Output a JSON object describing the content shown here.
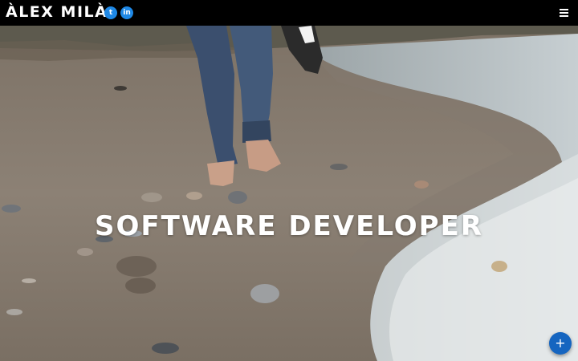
{
  "header": {
    "brand": "ÀLEX MILÀ",
    "social": [
      {
        "name": "twitter",
        "glyph": "t"
      },
      {
        "name": "linkedin",
        "glyph": "in"
      }
    ],
    "menu_icon": "hamburger-icon"
  },
  "hero": {
    "headline": "SOFTWARE DEVELOPER",
    "background": "beach-footsteps-photo"
  },
  "fab": {
    "glyph": "+",
    "icon": "plus-icon"
  },
  "colors": {
    "topbar": "#000000",
    "accent": "#1e88e5",
    "fab": "#1565c0",
    "text": "#ffffff"
  }
}
